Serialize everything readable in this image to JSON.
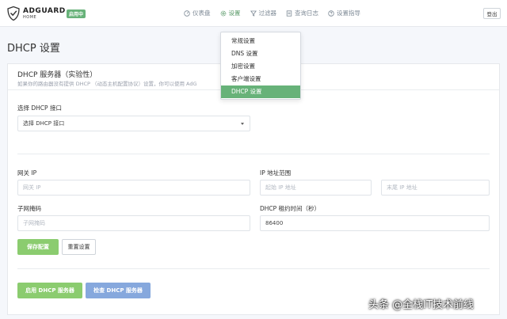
{
  "header": {
    "logo_name": "ADGUARD",
    "logo_sub": "HOME",
    "badge": "启用中",
    "nav": [
      {
        "label": "仪表盘",
        "icon": "dashboard-icon"
      },
      {
        "label": "设置",
        "icon": "gear-icon"
      },
      {
        "label": "过滤器",
        "icon": "filter-icon"
      },
      {
        "label": "查询日志",
        "icon": "log-icon"
      },
      {
        "label": "设置指导",
        "icon": "guide-icon"
      }
    ],
    "logout": "登出"
  },
  "dropdown": {
    "items": [
      "常规设置",
      "DNS 设置",
      "加密设置",
      "客户端设置",
      "DHCP 设置"
    ],
    "active_index": 4
  },
  "page": {
    "title": "DHCP 设置"
  },
  "card": {
    "title": "DHCP 服务器（实验性）",
    "subtitle": "如果你的路由器没有提供 DHCP （动态主机配置协议）设置，你可以使用 AdG"
  },
  "form": {
    "interface_label": "选择 DHCP 接口",
    "interface_value": "选择 DHCP 接口",
    "gateway_label": "网关 IP",
    "gateway_placeholder": "网关 IP",
    "range_label": "IP 地址范围",
    "range_start_placeholder": "起始 IP 地址",
    "range_end_placeholder": "末尾 IP 地址",
    "subnet_label": "子网掩码",
    "subnet_placeholder": "子网掩码",
    "lease_label": "DHCP 租约时间（秒）",
    "lease_value": "86400",
    "save_button": "保存配置",
    "reset_button": "重置设置",
    "enable_button": "启用 DHCP 服务器",
    "check_button": "检查 DHCP 服务器"
  },
  "watermark": "头条 @全栈IT技术前线",
  "colors": {
    "accent_green": "#67b279",
    "button_green": "#8bcc6f",
    "button_blue": "#86a8dd"
  }
}
